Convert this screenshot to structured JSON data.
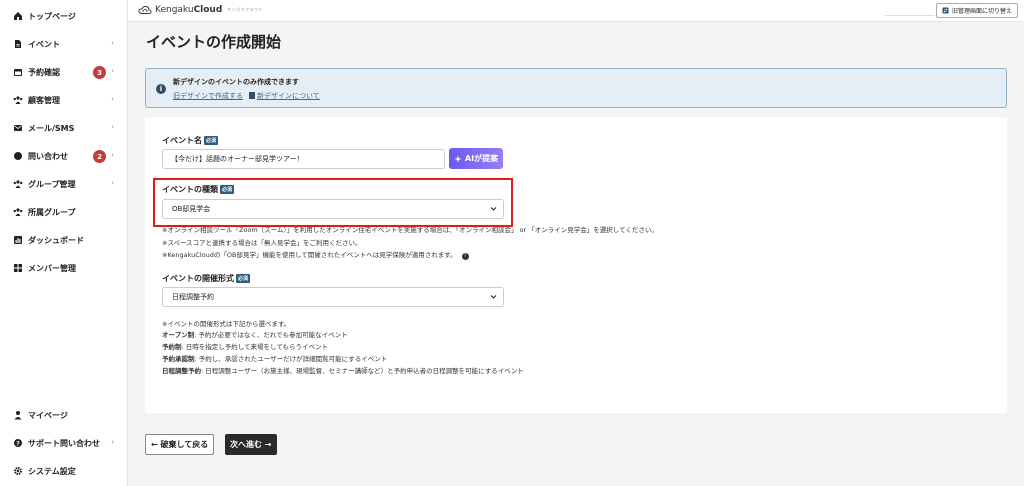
{
  "sidebar": {
    "items": [
      {
        "label": "トップページ",
        "icon": "home-icon",
        "chevron": false,
        "badge": null
      },
      {
        "label": "イベント",
        "icon": "document-icon",
        "chevron": true,
        "badge": null
      },
      {
        "label": "予約確認",
        "icon": "calendar-icon",
        "chevron": true,
        "badge": "3"
      },
      {
        "label": "顧客管理",
        "icon": "users-icon",
        "chevron": true,
        "badge": null
      },
      {
        "label": "メール/SMS",
        "icon": "mail-icon",
        "chevron": true,
        "badge": null
      },
      {
        "label": "問い合わせ",
        "icon": "chat-icon",
        "chevron": true,
        "badge": "2"
      },
      {
        "label": "グループ管理",
        "icon": "group-icon",
        "chevron": true,
        "badge": null
      },
      {
        "label": "所属グループ",
        "icon": "group-icon",
        "chevron": false,
        "badge": null
      },
      {
        "label": "ダッシュボード",
        "icon": "chart-icon",
        "chevron": false,
        "badge": null
      },
      {
        "label": "メンバー管理",
        "icon": "grid-icon",
        "chevron": false,
        "badge": null
      }
    ],
    "bottom_items": [
      {
        "label": "マイページ",
        "icon": "person-icon",
        "chevron": false
      },
      {
        "label": "サポート問い合わせ",
        "icon": "question-icon",
        "chevron": true
      },
      {
        "label": "システム設定",
        "icon": "gear-icon",
        "chevron": false
      }
    ],
    "chevron_glyph": "›"
  },
  "topbar": {
    "logo_light": "Kengaku",
    "logo_bold": "Cloud",
    "logo_tag": "ケンガククラウド",
    "switch_label": "旧管理画面に切り替え"
  },
  "page": {
    "title": "イベントの作成開始"
  },
  "notice": {
    "title": "新デザインのイベントのみ作成できます",
    "link_old": "旧デザインで作成する",
    "link_new": "新デザインについて",
    "info_glyph": "i"
  },
  "form": {
    "required_tag": "必須",
    "event_name_label": "イベント名",
    "event_name_value": "【今だけ】話題のオーナー邸見学ツアー！",
    "ai_button": "AIが提案",
    "event_type_label": "イベントの種類",
    "event_type_value": "OB邸見学会",
    "event_type_help": [
      "※オンライン相談ツール「Zoom（ズーム）」を利用したオンライン住宅イベントを実施する場合は、「オンライン相談会」 or 「オンライン見学会」を選択してください。",
      "※スペースコアと連携する場合は「無人見学会」をご利用ください。",
      "※KengakuCloudの「OB邸見学」機能を使用して開催されたイベントへは見学保険が適用されます。"
    ],
    "format_label": "イベントの開催形式",
    "format_value": "日程調整予約",
    "format_help_intro": "※イベントの開催形式は下記から選べます。",
    "format_help": [
      {
        "term": "オープン制",
        "desc": ": 予約が必要ではなく、だれでも参加可能なイベント"
      },
      {
        "term": "予約制",
        "desc": ": 日時を指定し予約して来場をしてもらうイベント"
      },
      {
        "term": "予約承認制",
        "desc": ": 予約し、承認されたユーザーだけが詳細閲覧可能にするイベント"
      },
      {
        "term": "日程調整予約",
        "desc": ": 日程調整ユーザー（お施主様、現場監督、セミナー講師など）と予約申込者の日程調整を可能にするイベント"
      }
    ]
  },
  "footer": {
    "back_button": "← 破棄して戻る",
    "next_button": "次へ進む →"
  },
  "colors": {
    "accent_dark": "#2a2a2a",
    "badge_red": "#c43c3c",
    "highlight_red": "#e01b1b",
    "required_tag": "#2e5f7a",
    "ai_gradient_start": "#6a5cf0",
    "ai_gradient_end": "#9a7cf5",
    "notice_bg": "#e4eef4"
  }
}
